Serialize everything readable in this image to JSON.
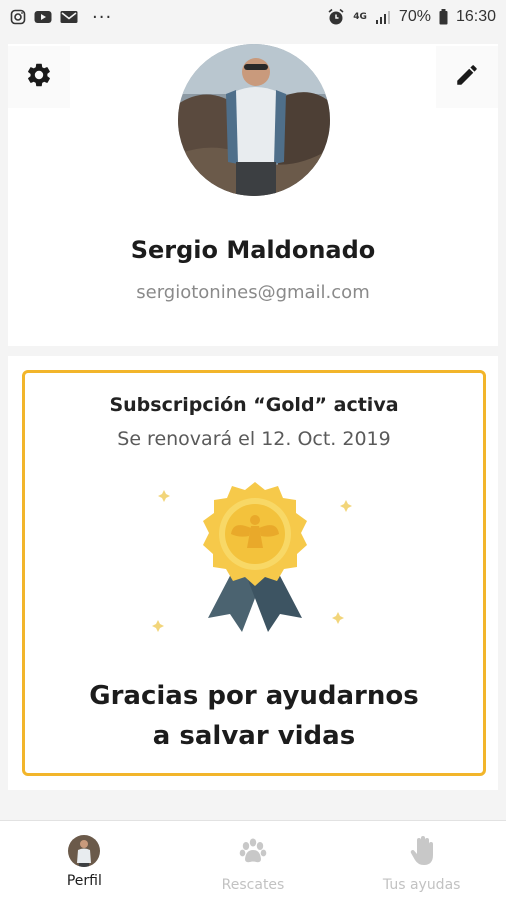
{
  "status_bar": {
    "battery": "70%",
    "time": "16:30",
    "network": "4G",
    "icons_left": [
      "instagram-icon",
      "youtube-icon",
      "gmail-icon",
      "more-dots-icon"
    ],
    "icons_right": [
      "alarm-icon",
      "signal-icon",
      "battery-icon"
    ]
  },
  "profile": {
    "name": "Sergio Maldonado",
    "email": "sergiotonines@gmail.com",
    "settings_icon": "gear-icon",
    "edit_icon": "pencil-icon"
  },
  "subscription": {
    "title": "Subscripción “Gold” activa",
    "renewal": "Se renovará el 12. Oct. 2019",
    "thanks_line1": "Gracias por ayudarnos",
    "thanks_line2": "a salvar vidas",
    "accent_color": "#f2b52a"
  },
  "bottom_nav": {
    "items": [
      {
        "label": "Perfil",
        "icon": "avatar",
        "active": true
      },
      {
        "label": "Rescates",
        "icon": "paw-icon",
        "active": false
      },
      {
        "label": "Tus ayudas",
        "icon": "hand-icon",
        "active": false
      }
    ]
  }
}
